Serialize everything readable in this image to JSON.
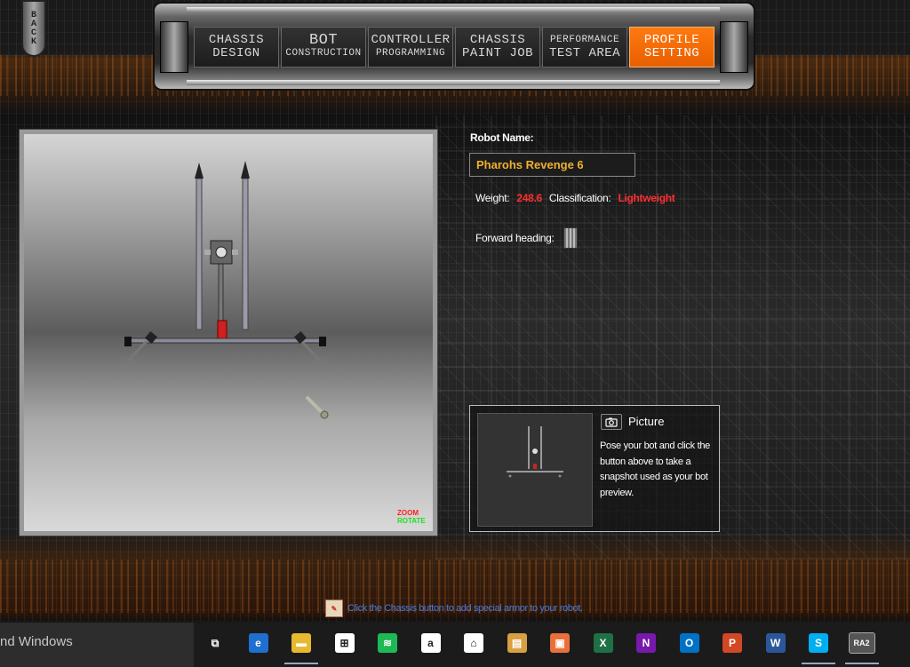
{
  "back_button": {
    "label": "BACK"
  },
  "nav": {
    "tabs": [
      {
        "line1": "CHASSIS",
        "line2": "DESIGN"
      },
      {
        "line1": "BOT",
        "line2": "CONSTRUCTION"
      },
      {
        "line1": "CONTROLLER",
        "line2": "PROGRAMMING"
      },
      {
        "line1": "CHASSIS",
        "line2": "PAINT JOB"
      },
      {
        "line1": "PERFORMANCE",
        "line2": "TEST AREA"
      },
      {
        "line1": "PROFILE",
        "line2": "SETTING"
      }
    ],
    "active_tab": "PROFILE SETTING"
  },
  "viewer": {
    "zoom_label": "ZOOM",
    "rotate_label": "ROTATE"
  },
  "profile": {
    "name_label": "Robot Name:",
    "name_value": "Pharohs Revenge 6",
    "weight_label": "Weight:",
    "weight_value": "248.6",
    "classification_label": "Classification:",
    "classification_value": "Lightweight",
    "heading_label": "Forward heading:"
  },
  "picture": {
    "title": "Picture",
    "description": "Pose your bot and click the button above to take a snapshot used as your bot preview."
  },
  "tip": {
    "text": "Click the Chassis button to add special armor to your robot."
  },
  "taskbar": {
    "search_text": "nd Windows",
    "apps": [
      {
        "name": "task-view",
        "glyph": "⧉",
        "color": "#1b1b1b"
      },
      {
        "name": "edge",
        "glyph": "e",
        "color": "#1f6fd0"
      },
      {
        "name": "file-explorer",
        "glyph": "▬",
        "color": "#e8b830"
      },
      {
        "name": "store",
        "glyph": "⊞",
        "color": "#ffffff"
      },
      {
        "name": "spotify",
        "glyph": "≋",
        "color": "#1db954"
      },
      {
        "name": "amazon",
        "glyph": "a",
        "color": "#ffffff"
      },
      {
        "name": "home",
        "glyph": "⌂",
        "color": "#ffffff"
      },
      {
        "name": "notes",
        "glyph": "▤",
        "color": "#d8a040"
      },
      {
        "name": "photos",
        "glyph": "▣",
        "color": "#e8703a"
      },
      {
        "name": "excel",
        "glyph": "X",
        "color": "#1e7145"
      },
      {
        "name": "onenote",
        "glyph": "N",
        "color": "#7719aa"
      },
      {
        "name": "outlook",
        "glyph": "O",
        "color": "#0072c6"
      },
      {
        "name": "powerpoint",
        "glyph": "P",
        "color": "#d24726"
      },
      {
        "name": "word",
        "glyph": "W",
        "color": "#2b579a"
      },
      {
        "name": "skype",
        "glyph": "S",
        "color": "#00aff0"
      },
      {
        "name": "ra2",
        "glyph": "RA2",
        "color": "#555555"
      }
    ]
  }
}
